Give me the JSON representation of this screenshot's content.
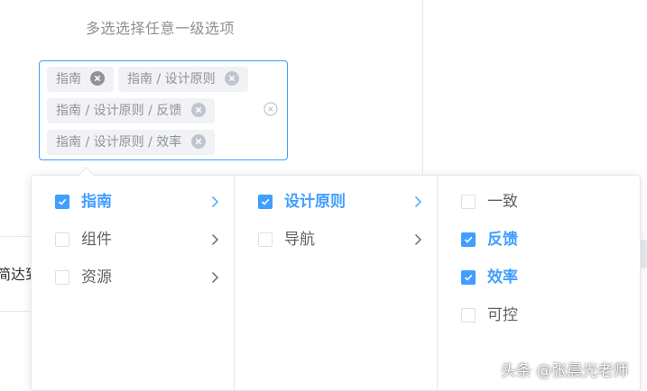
{
  "hint": "多选选择任意一级选项",
  "background_text": "简达到",
  "select": {
    "tags": [
      {
        "label": "指南",
        "active": true
      },
      {
        "label": "指南 / 设计原则",
        "active": false
      },
      {
        "label": "指南 / 设计原则 / 反馈",
        "active": false
      },
      {
        "label": "指南 / 设计原则 / 效率",
        "active": false
      }
    ],
    "clear_icon": "circle-close-icon"
  },
  "cascader": {
    "menus": [
      {
        "items": [
          {
            "label": "指南",
            "checked": true,
            "has_children": true
          },
          {
            "label": "组件",
            "checked": false,
            "has_children": true
          },
          {
            "label": "资源",
            "checked": false,
            "has_children": true
          }
        ]
      },
      {
        "items": [
          {
            "label": "设计原则",
            "checked": true,
            "has_children": true
          },
          {
            "label": "导航",
            "checked": false,
            "has_children": true
          }
        ]
      },
      {
        "items": [
          {
            "label": "一致",
            "checked": false,
            "has_children": false
          },
          {
            "label": "反馈",
            "checked": true,
            "has_children": false
          },
          {
            "label": "效率",
            "checked": true,
            "has_children": false
          },
          {
            "label": "可控",
            "checked": false,
            "has_children": false
          }
        ]
      }
    ]
  },
  "watermark": "头条 @张晨光老师",
  "colors": {
    "accent": "#409eff",
    "text": "#606266",
    "tag_bg": "#f0f2f5",
    "border": "#e4e7ed"
  }
}
